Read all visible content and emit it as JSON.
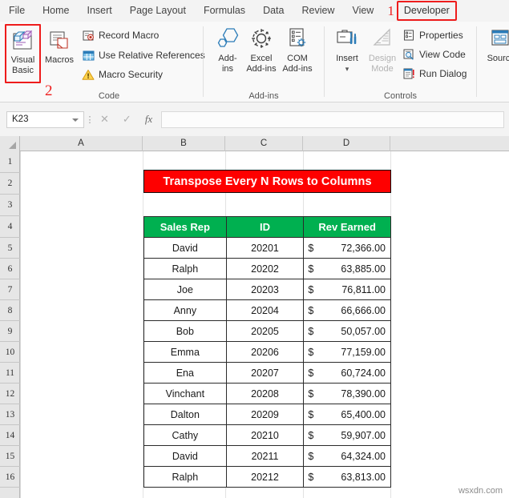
{
  "ribbon_tabs": [
    {
      "label": "File",
      "active": false
    },
    {
      "label": "Home",
      "active": false
    },
    {
      "label": "Insert",
      "active": false
    },
    {
      "label": "Page Layout",
      "active": false
    },
    {
      "label": "Formulas",
      "active": false
    },
    {
      "label": "Data",
      "active": false
    },
    {
      "label": "Review",
      "active": false
    },
    {
      "label": "View",
      "active": false
    },
    {
      "label": "Developer",
      "active": true
    }
  ],
  "annotations": {
    "marker_one": "1",
    "marker_two": "2"
  },
  "ribbon": {
    "code_group": {
      "label": "Code",
      "visual_basic": "Visual\nBasic",
      "visual_basic_line1": "Visual",
      "visual_basic_line2": "Basic",
      "macros": "Macros",
      "record_macro": "Record Macro",
      "use_relative_references": "Use Relative References",
      "macro_security": "Macro Security"
    },
    "addins_group": {
      "label": "Add-ins",
      "addins_line1": "Add-",
      "addins_line2": "ins",
      "excel_addins_line1": "Excel",
      "excel_addins_line2": "Add-ins",
      "com_addins_line1": "COM",
      "com_addins_line2": "Add-ins"
    },
    "controls_group": {
      "label": "Controls",
      "insert": "Insert",
      "design_mode_line1": "Design",
      "design_mode_line2": "Mode",
      "properties": "Properties",
      "view_code": "View Code",
      "run_dialog": "Run Dialog"
    },
    "xml_group": {
      "source": "Source"
    }
  },
  "formula_bar": {
    "name_box_value": "K23",
    "formula_value": "",
    "cancel_icon": "✕",
    "enter_icon": "✓",
    "function_icon": "fx"
  },
  "grid": {
    "columns": [
      "A",
      "B",
      "C",
      "D"
    ],
    "rows": [
      "1",
      "2",
      "3",
      "4",
      "5",
      "6",
      "7",
      "8",
      "9",
      "10",
      "11",
      "12",
      "13",
      "14",
      "15",
      "16"
    ]
  },
  "banner": {
    "text": "Transpose Every N Rows to Columns",
    "bg_color": "#FE0000",
    "text_color": "#FFFFFF"
  },
  "table": {
    "header_bg": "#00B050",
    "headers": [
      "Sales Rep",
      "ID",
      "Rev Earned"
    ],
    "rows": [
      {
        "sales_rep": "David",
        "id": "20201",
        "currency": "$",
        "rev_earned": "72,366.00"
      },
      {
        "sales_rep": "Ralph",
        "id": "20202",
        "currency": "$",
        "rev_earned": "63,885.00"
      },
      {
        "sales_rep": "Joe",
        "id": "20203",
        "currency": "$",
        "rev_earned": "76,811.00"
      },
      {
        "sales_rep": "Anny",
        "id": "20204",
        "currency": "$",
        "rev_earned": "66,666.00"
      },
      {
        "sales_rep": "Bob",
        "id": "20205",
        "currency": "$",
        "rev_earned": "50,057.00"
      },
      {
        "sales_rep": "Emma",
        "id": "20206",
        "currency": "$",
        "rev_earned": "77,159.00"
      },
      {
        "sales_rep": "Ena",
        "id": "20207",
        "currency": "$",
        "rev_earned": "60,724.00"
      },
      {
        "sales_rep": "Vinchant",
        "id": "20208",
        "currency": "$",
        "rev_earned": "78,390.00"
      },
      {
        "sales_rep": "Dalton",
        "id": "20209",
        "currency": "$",
        "rev_earned": "65,400.00"
      },
      {
        "sales_rep": "Cathy",
        "id": "20210",
        "currency": "$",
        "rev_earned": "59,907.00"
      },
      {
        "sales_rep": "David",
        "id": "20211",
        "currency": "$",
        "rev_earned": "64,324.00"
      },
      {
        "sales_rep": "Ralph",
        "id": "20212",
        "currency": "$",
        "rev_earned": "63,813.00"
      }
    ]
  },
  "watermark": "wsxdn.com"
}
